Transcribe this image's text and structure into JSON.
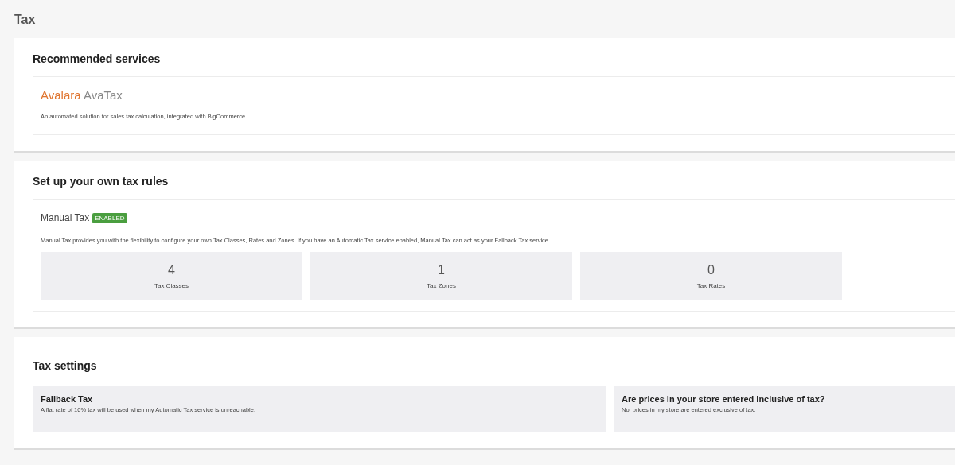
{
  "page_title": "Tax",
  "recommended": {
    "heading": "Recommended services",
    "service": {
      "brand": "Avalara",
      "product": "AvaTax",
      "description": "An automated solution for sales tax calculation, integrated with BigCommerce."
    }
  },
  "own_rules": {
    "heading": "Set up your own tax rules",
    "manual_tax": {
      "title": "Manual Tax",
      "badge": "ENABLED",
      "description": "Manual Tax provides you with the flexibility to configure your own Tax Classes, Rates and Zones. If you have an Automatic Tax service enabled, Manual Tax can act as your Fallback Tax service.",
      "stats": [
        {
          "value": "4",
          "label": "Tax Classes"
        },
        {
          "value": "1",
          "label": "Tax Zones"
        },
        {
          "value": "0",
          "label": "Tax Rates"
        }
      ]
    }
  },
  "tax_settings": {
    "heading": "Tax settings",
    "items": [
      {
        "title": "Fallback Tax",
        "description": "A flat rate of 10% tax will be used when my Automatic Tax service is unreachable."
      },
      {
        "title": "Are prices in your store entered inclusive of tax?",
        "description": "No, prices in my store are entered exclusive of tax."
      }
    ]
  }
}
